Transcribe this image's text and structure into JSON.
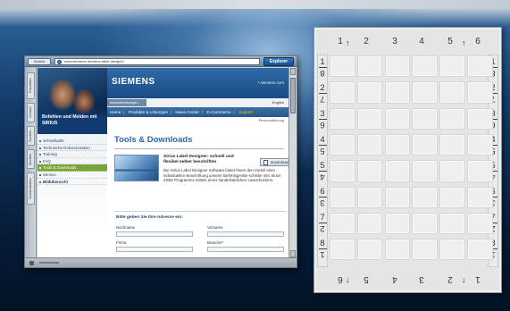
{
  "browser": {
    "back_label": "Zurück",
    "address": "www.siemens.de/sirius-label-designer",
    "explore_label": "Explorer",
    "side_tabs": [
      "Favoriten",
      "Verlauf",
      "Suchen",
      "Medien",
      "Sondertasten"
    ],
    "status_text": "Internetzone"
  },
  "page": {
    "brand": "SIEMENS",
    "brand_url": "• siemens.com",
    "subnav_lead": "Industrielösungen",
    "lang": "English",
    "nav_items": [
      "Home",
      "Produkte & Lösungen",
      "News Center",
      "E-Commerce",
      "Support"
    ],
    "nav_active_index": 4,
    "personalize": "Personalisierung",
    "hero_text": "Befehlen und Melden mit SIRIUS",
    "left_nav": [
      {
        "label": "Schnellwahl",
        "active": false,
        "bold": false
      },
      {
        "label": "Technische Dokumentation",
        "active": false,
        "bold": false
      },
      {
        "label": "Training",
        "active": false,
        "bold": false
      },
      {
        "label": "FAQ",
        "active": false,
        "bold": false
      },
      {
        "label": "Tools & Downloads",
        "active": true,
        "bold": false
      },
      {
        "label": "Service",
        "active": false,
        "bold": false
      },
      {
        "label": "Bildübersicht",
        "active": false,
        "bold": true
      }
    ],
    "section_title": "Tools & Downloads",
    "product_heading": "Sirius Label Designer: schnell und flexibel selber beschriften",
    "download_label": "Download",
    "product_desc": "Die Sirius Label Designer Software bietet Ihnen den Vorteil einer individuellen Beschriftung unserer Befehlsgeräte-schilder des Sirius 3SB3 Programms mittels eines handelsüblichen Laserdruckers.",
    "form_title": "Bitte geben Sie Ihre Adresse ein:",
    "form_fields": {
      "nachname": "Nachname",
      "vorname": "Vorname",
      "firma": "Firma",
      "branche": "Branche*"
    }
  },
  "label_grid": {
    "columns_top": [
      "1",
      "2",
      "3",
      "4",
      "5",
      "6"
    ],
    "columns_bottom": [
      "6",
      "5",
      "4",
      "3",
      "2",
      "1"
    ],
    "rows": [
      "1",
      "2",
      "3",
      "4",
      "5",
      "6",
      "7",
      "8"
    ],
    "rows_flipped": [
      "8",
      "7",
      "6",
      "5",
      "4",
      "3",
      "2",
      "1"
    ],
    "arrow_up": "↑",
    "arrow_down": "↓"
  },
  "colors": {
    "siemens_blue": "#1b4c86",
    "link_blue": "#2a69ad",
    "active_green": "#7aa43a",
    "support_yellow": "#f2c200"
  }
}
